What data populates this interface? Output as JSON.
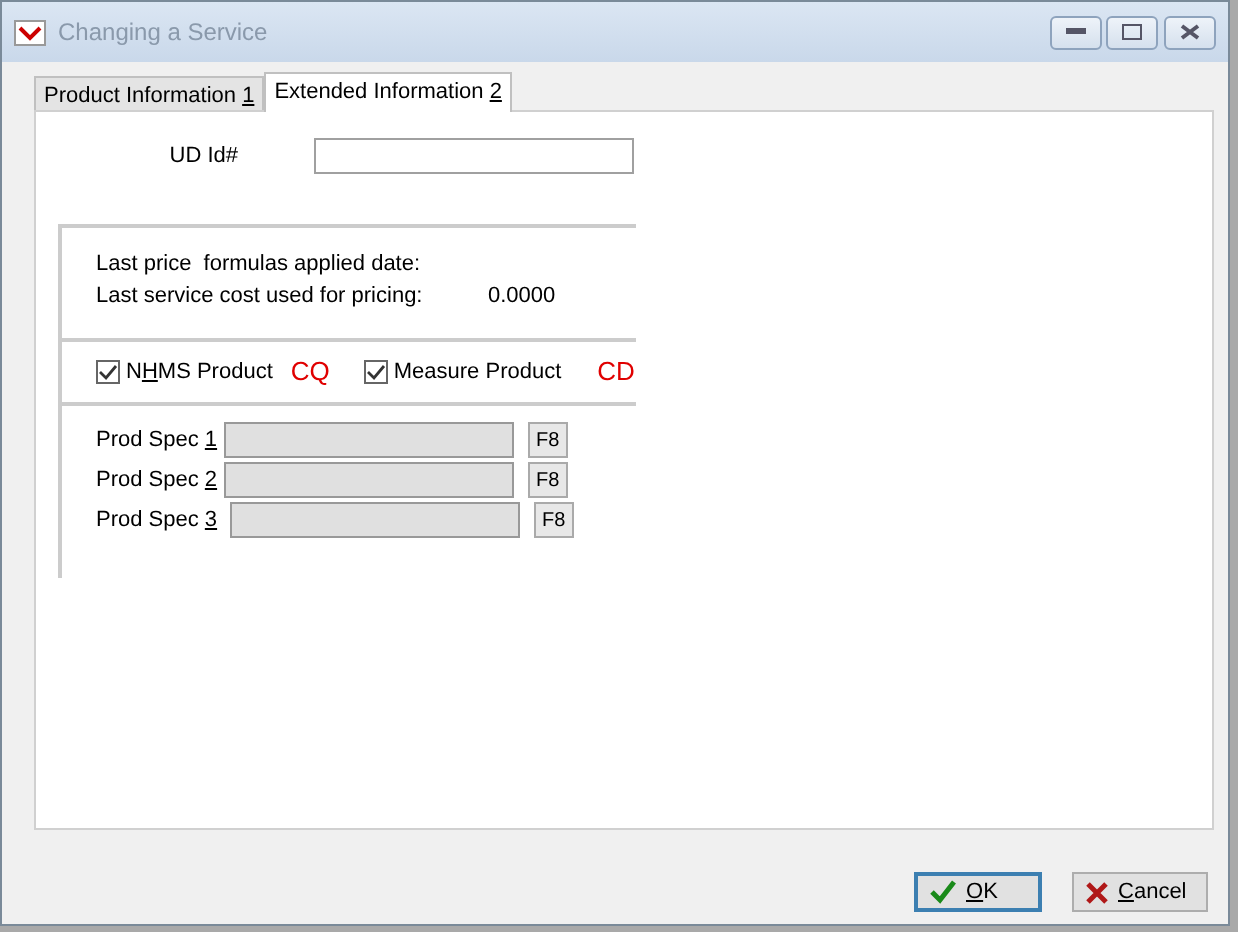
{
  "window": {
    "title": "Changing a Service"
  },
  "tabs": [
    {
      "label": [
        {
          "text": "Product Information "
        },
        {
          "text": "1",
          "underline": true
        }
      ],
      "selected": false
    },
    {
      "label": [
        {
          "text": "Extended Information "
        },
        {
          "text": "2",
          "underline": true
        }
      ],
      "selected": true
    }
  ],
  "ud_id": {
    "label": "UD Id#"
  },
  "pricing": [
    {
      "label": "Last price  formulas applied date:"
    },
    {
      "label": "Last service cost used for pricing:",
      "value": "0.0000"
    }
  ],
  "checkboxes": [
    {
      "label": [
        {
          "text": "N"
        },
        {
          "text": "H",
          "underline": true
        },
        {
          "text": "MS Product"
        }
      ],
      "checked": true,
      "code": "CQ"
    },
    {
      "label": [
        {
          "text": "Measure Product"
        }
      ],
      "checked": true,
      "code": "CD"
    }
  ],
  "prod_specs": [
    {
      "label": [
        {
          "text": "Prod Spec "
        },
        {
          "text": "1",
          "underline": true
        }
      ],
      "disabled": true,
      "key": "F8"
    },
    {
      "label": [
        {
          "text": "Prod Spec "
        },
        {
          "text": "2",
          "underline": true
        }
      ],
      "disabled": true,
      "key": "F8"
    },
    {
      "label": [
        {
          "text": "Prod Spec "
        },
        {
          "text": "3",
          "underline": true
        }
      ],
      "disabled": true,
      "key": "F8"
    }
  ],
  "buttons": [
    {
      "kind": "ok",
      "label": [
        {
          "text": "O",
          "underline": true
        },
        {
          "text": "K"
        }
      ],
      "default": true
    },
    {
      "kind": "cancel",
      "label": [
        {
          "text": "C",
          "underline": true
        },
        {
          "text": "ancel"
        }
      ],
      "default": false
    }
  ]
}
